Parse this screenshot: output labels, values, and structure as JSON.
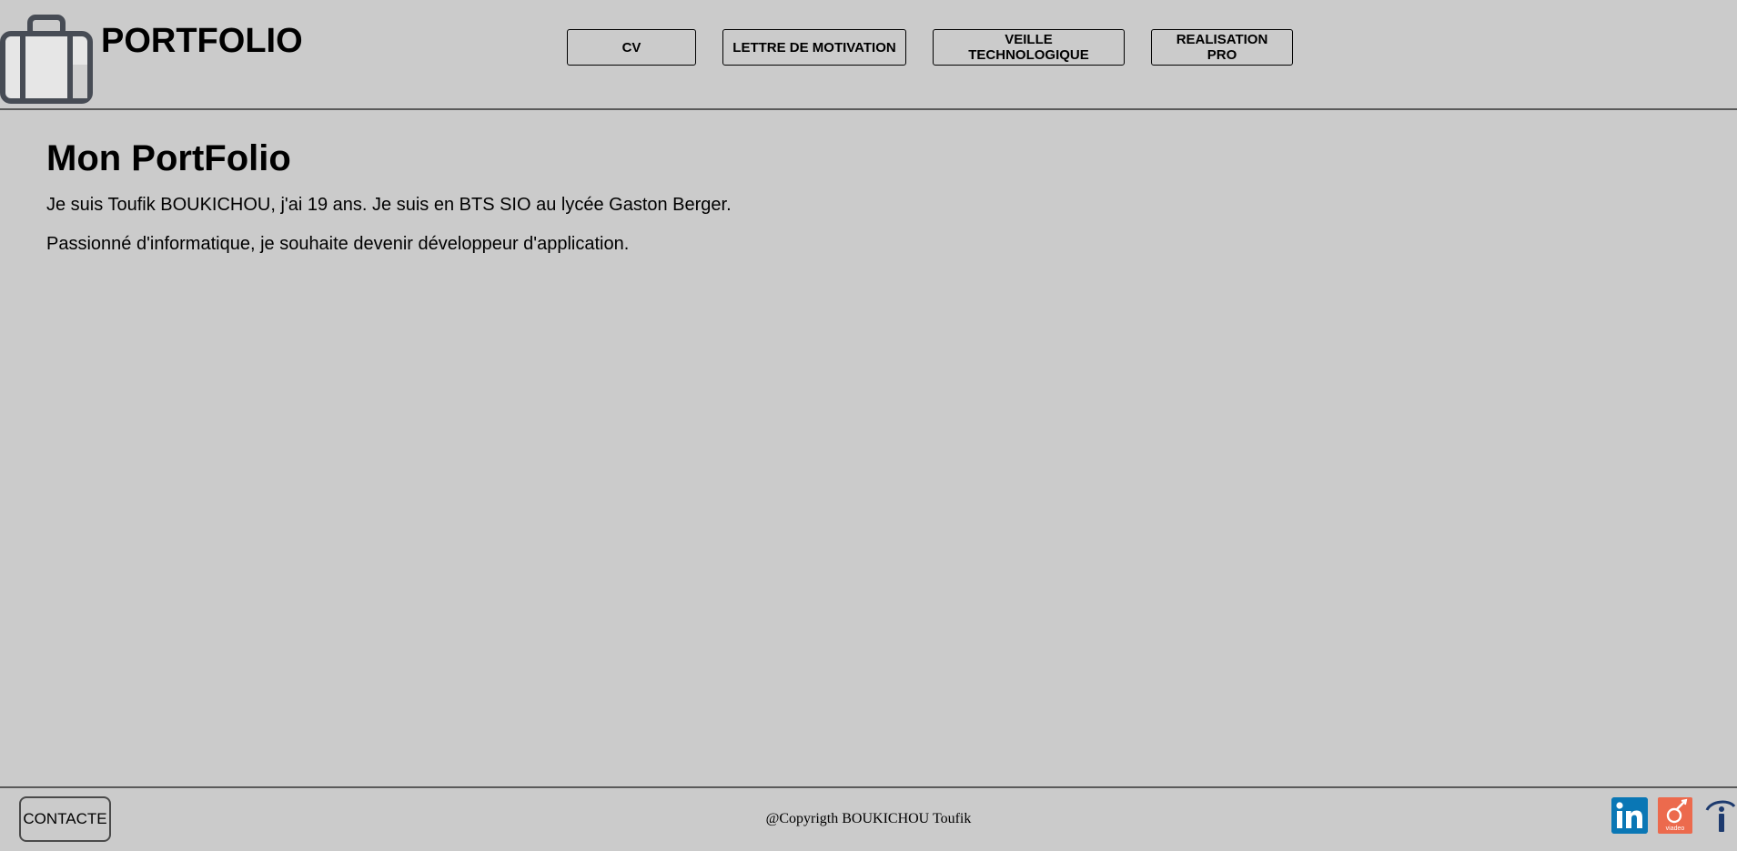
{
  "header": {
    "site_title": "PORTFOLIO",
    "logo_icon": "briefcase-icon",
    "nav": [
      {
        "label": "CV"
      },
      {
        "label": "LETTRE DE MOTIVATION"
      },
      {
        "label": "VEILLE TECHNOLOGIQUE"
      },
      {
        "label": "REALISATION PRO"
      }
    ]
  },
  "main": {
    "title": "Mon PortFolio",
    "paragraphs": [
      "Je suis Toufik BOUKICHOU, j'ai 19 ans. Je suis en BTS SIO au lycée Gaston Berger.",
      "Passionné d'informatique, je souhaite devenir développeur d'application."
    ]
  },
  "footer": {
    "contact_label": "CONTACTE",
    "copyright": "@Copyrigth BOUKICHOU Toufik",
    "social": [
      {
        "icon": "linkedin-icon",
        "color": "#0a77b5",
        "text": "in"
      },
      {
        "icon": "viadeo-icon",
        "color": "#ec6a4d",
        "text": "viadeo"
      },
      {
        "icon": "info-icon",
        "color": "#1d3a6e"
      }
    ]
  },
  "colors": {
    "background": "#cbcbcb",
    "border": "#5a5a5a",
    "icon_dark": "#474c55"
  }
}
